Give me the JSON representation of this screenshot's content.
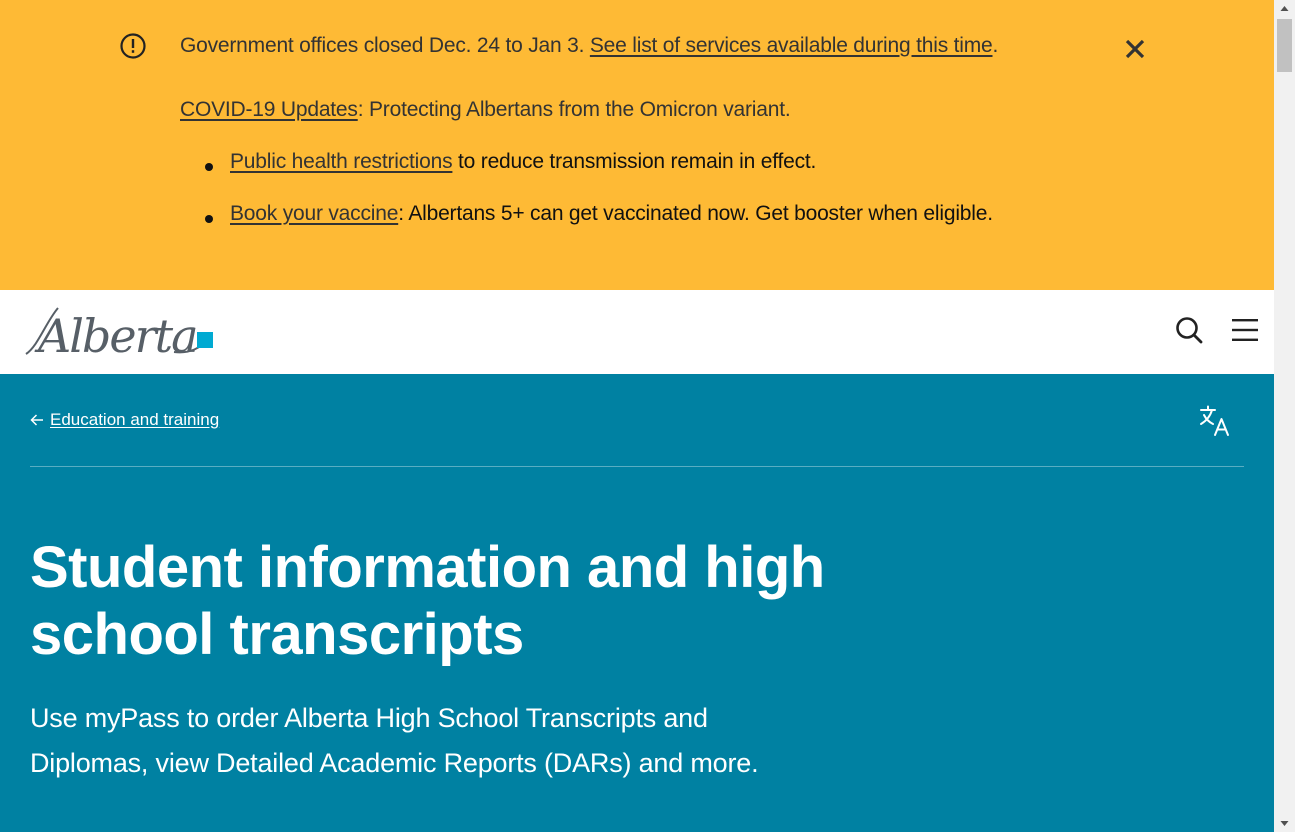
{
  "alert": {
    "closure_text": "Government offices closed Dec. 24 to Jan 3. ",
    "closure_link": "See list of services available during this time",
    "closure_suffix": ".",
    "covid_link": "COVID-19 Updates",
    "covid_text": ": Protecting Albertans from the Omicron variant.",
    "bullets": [
      {
        "link": "Public health restrictions",
        "text": " to reduce transmission remain in effect."
      },
      {
        "link": "Book your vaccine",
        "text": ": Albertans 5+ can get vaccinated now. Get booster when eligible."
      }
    ],
    "background": "#FEBA35"
  },
  "header": {
    "logo_text": "Alberta",
    "logo_accent": "#00AAD2",
    "icons": [
      "search-icon",
      "menu-icon"
    ]
  },
  "hero": {
    "breadcrumb": "Education and training",
    "title": "Student information and high school transcripts",
    "lead": "Use myPass to order Alberta High School Transcripts and Diplomas, view Detailed Academic Reports (DARs) and more.",
    "background": "#0081A2",
    "icons": [
      "arrow-left-icon",
      "translate-icon"
    ]
  }
}
